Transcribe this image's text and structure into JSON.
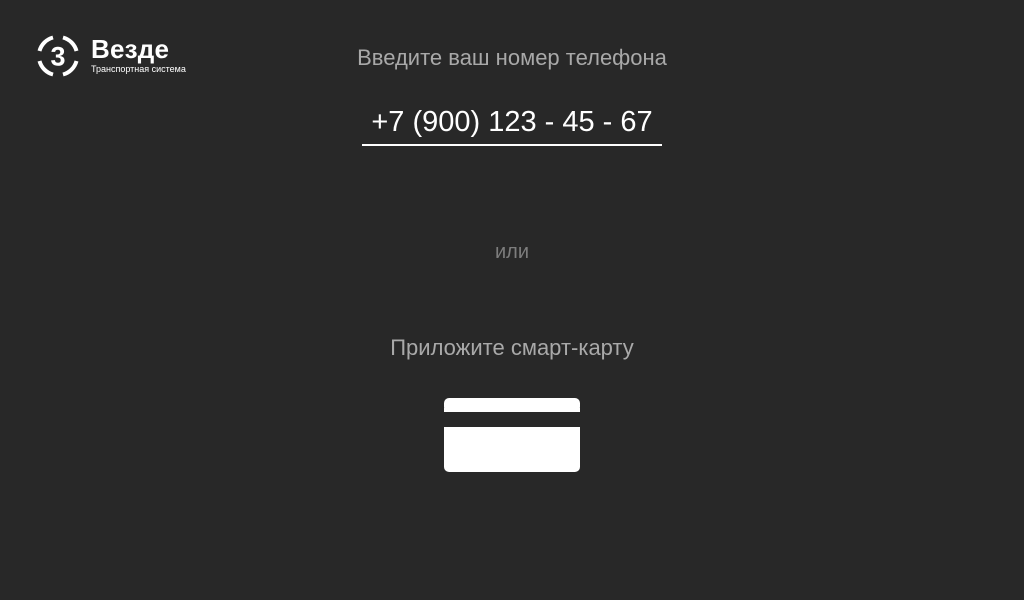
{
  "brand": {
    "name": "Везде",
    "tagline": "Транспортная система",
    "logo_glyph": "3",
    "icon": "brand-logo-icon"
  },
  "phone": {
    "prompt": "Введите ваш номер телефона",
    "value": "+7 (900) 123 - 45 - 67"
  },
  "separator": {
    "text": "или"
  },
  "card": {
    "prompt": "Приложите смарт-карту",
    "icon": "smart-card-icon"
  },
  "colors": {
    "background": "#282828",
    "primary_text": "#ffffff",
    "secondary_text": "#a9a9a9",
    "muted_text": "#7d7d7d"
  }
}
